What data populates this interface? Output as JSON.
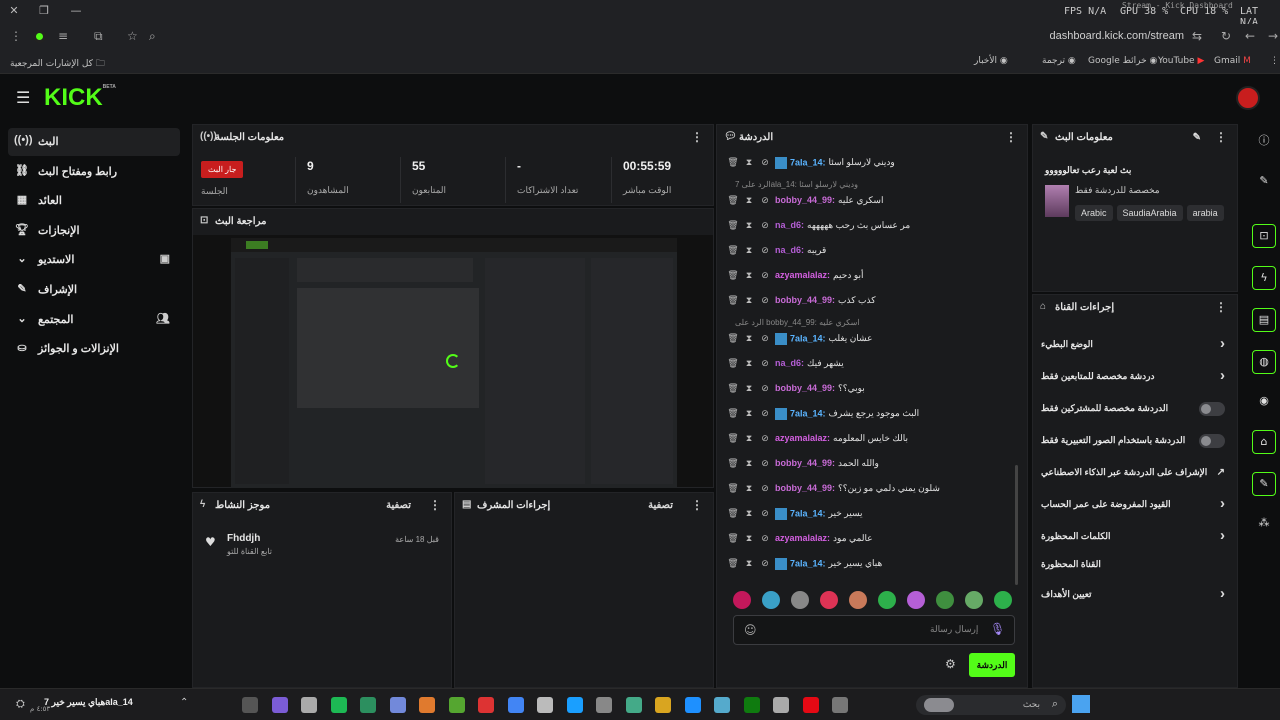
{
  "overlay": {
    "fps": "FPS N/A",
    "gpu": "GPU 38 %",
    "cpu": "CPU 18 %",
    "lat": "LAT N/A",
    "tab": "Stream - Kick Dashboard"
  },
  "browser": {
    "url": "dashboard.kick.com/stream",
    "bookmarks": {
      "all": "كل الإشارات المرجعية",
      "gmail": "Gmail",
      "youtube": "YouTube",
      "maps": "Google خرائط",
      "translate": "ترجمة",
      "news": "الأخبار"
    }
  },
  "app": {
    "logo": "KICK",
    "logo_sup": "BETA",
    "nav": {
      "stream": "البث",
      "stream_key": "رابط ومفتاح البث",
      "revenue": "العائد",
      "achievements": "الإنجازات",
      "studio": "الاستديو",
      "moderation": "الإشراف",
      "community": "المجتمع",
      "payouts": "الإنزالات و الجوائز"
    }
  },
  "session": {
    "title": "معلومات الجلسة",
    "live_badge": "جار البث",
    "session_label": "الجلسة",
    "viewers_value": "9",
    "viewers_label": "المشاهدون",
    "followers_value": "55",
    "followers_label": "المتابعون",
    "subs_value": "-",
    "subs_label": "تعداد الاشتراكات",
    "time_value": "00:55:59",
    "time_label": "الوقت مباشر"
  },
  "preview": {
    "title": "مراجعة البث"
  },
  "activity": {
    "title": "موجز النشاط",
    "filter": "تصفية",
    "item_name": "Fhddjh",
    "item_desc": "تابع القناة للتو",
    "item_time": "قبل 18 ساعة"
  },
  "modactions": {
    "title": "إجراءات المشرف",
    "filter": "تصفية"
  },
  "chat": {
    "title": "الدردشة",
    "placeholder": "إرسال رسالة",
    "send": "الدردشة",
    "messages": [
      {
        "user": "7ala_14:",
        "text": "وديني لارسلو اسئا",
        "color": "#5ab4ff",
        "badge": true
      },
      {
        "reply": "الرد على 7ala_14: وديني لارسلو اسئا"
      },
      {
        "user": "bobby_44_99:",
        "text": "اسكري عليه",
        "color": "#c86bd6",
        "badge": false
      },
      {
        "user": "na_d6:",
        "text": "مر عساس بث رحب هههههه",
        "color": "#b55fd6",
        "badge": false
      },
      {
        "user": "na_d6:",
        "text": "قريبه",
        "color": "#b55fd6",
        "badge": false
      },
      {
        "user": "azyamalalaz:",
        "text": "أبو دحيم",
        "color": "#d35fe0",
        "badge": false
      },
      {
        "user": "bobby_44_99:",
        "text": "كذب كذب",
        "color": "#c86bd6",
        "badge": false
      },
      {
        "reply": "الرد على bobby_44_99: اسكري عليه"
      },
      {
        "user": "7ala_14:",
        "text": "عشان يغلب",
        "color": "#5ab4ff",
        "badge": true
      },
      {
        "user": "na_d6:",
        "text": "يشهر فيك",
        "color": "#b55fd6",
        "badge": false
      },
      {
        "user": "bobby_44_99:",
        "text": "بوبي؟؟",
        "color": "#c86bd6",
        "badge": false
      },
      {
        "user": "7ala_14:",
        "text": "البث موجود يرجع يشرف",
        "color": "#5ab4ff",
        "badge": true
      },
      {
        "user": "azyamalalaz:",
        "text": "بالك خايس المعلومه",
        "color": "#d35fe0",
        "badge": false
      },
      {
        "user": "bobby_44_99:",
        "text": "والله الحمد",
        "color": "#c86bd6",
        "badge": false
      },
      {
        "user": "bobby_44_99:",
        "text": "شلون يمني دلمي مو زين؟؟",
        "color": "#c86bd6",
        "badge": false
      },
      {
        "user": "7ala_14:",
        "text": "يسير خير",
        "color": "#5ab4ff",
        "badge": true
      },
      {
        "user": "azyamalalaz:",
        "text": "عالمي مود",
        "color": "#d35fe0",
        "badge": false
      },
      {
        "user": "7ala_14:",
        "text": "هباي يسير خير",
        "color": "#5ab4ff",
        "badge": true
      }
    ]
  },
  "streaminfo": {
    "title": "معلومات البث",
    "stream_title": "بث لعبة رعب تعالووووو",
    "subtitle": "مخصصة للدردشة فقط",
    "tags": [
      "Arabic",
      "SaudiaArabia",
      "arabia"
    ]
  },
  "channelactions": {
    "title": "إجراءات القناة",
    "items": {
      "slow_mode": "الوضع البطيء",
      "followers_only": "دردشة مخصصة للمتابعين فقط",
      "subs_only": "الدردشة مخصصة للمشتركين فقط",
      "emotes_only": "الدردشة باستخدام الصور التعبيرية فقط",
      "ai_mod": "الإشراف على الدردشة عبر الذكاء الاصطناعي",
      "account_age": "القيود المفروضة على عمر الحساب",
      "banned_words": "الكلمات المحظورة",
      "blocked_channel": "القناة المحظورة",
      "goals": "تعيين الأهداف"
    }
  },
  "taskbar": {
    "search": "بحث",
    "media": "هباي يسير خير  7ala_14",
    "time": "٤:٥٣ م"
  }
}
